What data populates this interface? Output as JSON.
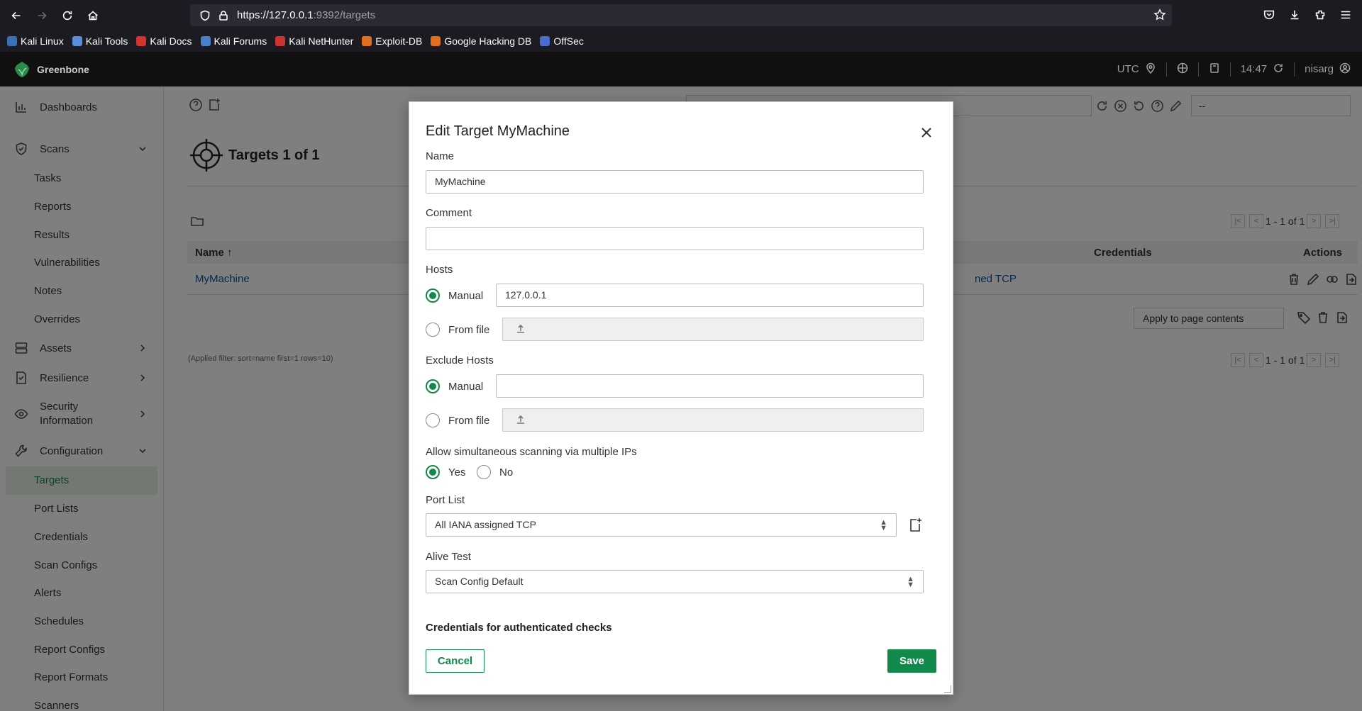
{
  "browser": {
    "url_host": "https://127.0.0.1",
    "url_rest": ":9392/targets",
    "bookmarks": [
      "Kali Linux",
      "Kali Tools",
      "Kali Docs",
      "Kali Forums",
      "Kali NetHunter",
      "Exploit-DB",
      "Google Hacking DB",
      "OffSec"
    ]
  },
  "header": {
    "brand": "Greenbone",
    "timezone": "UTC",
    "time": "14:47",
    "user": "nisarg"
  },
  "sidebar": {
    "dashboards": "Dashboards",
    "scans": "Scans",
    "scans_items": [
      "Tasks",
      "Reports",
      "Results",
      "Vulnerabilities",
      "Notes",
      "Overrides"
    ],
    "assets": "Assets",
    "resilience": "Resilience",
    "security_info_1": "Security",
    "security_info_2": "Information",
    "configuration": "Configuration",
    "config_items": [
      "Targets",
      "Port Lists",
      "Credentials",
      "Scan Configs",
      "Alerts",
      "Schedules",
      "Report Configs",
      "Report Formats",
      "Scanners"
    ]
  },
  "main": {
    "title": "Targets 1 of 1",
    "filter_select": "--",
    "pager_text": "1 - 1 of 1",
    "col_name": "Name",
    "col_credentials": "Credentials",
    "col_actions": "Actions",
    "row_name": "MyMachine",
    "row_portlist_partial": "ned TCP",
    "bulk_select": "Apply to page contents",
    "applied_filter": "(Applied filter: sort=name first=1 rows=10)"
  },
  "modal": {
    "title": "Edit Target MyMachine",
    "name_label": "Name",
    "name_value": "MyMachine",
    "comment_label": "Comment",
    "comment_value": "",
    "hosts_label": "Hosts",
    "manual": "Manual",
    "from_file": "From file",
    "hosts_value": "127.0.0.1",
    "exclude_label": "Exclude Hosts",
    "exclude_value": "",
    "simultaneous_label": "Allow simultaneous scanning via multiple IPs",
    "yes": "Yes",
    "no": "No",
    "portlist_label": "Port List",
    "portlist_value": "All IANA assigned TCP",
    "alive_label": "Alive Test",
    "alive_value": "Scan Config Default",
    "credentials_heading": "Credentials for authenticated checks",
    "cancel": "Cancel",
    "save": "Save"
  },
  "colors": {
    "accent": "#11894a",
    "link": "#0a53a8",
    "header_bg": "#101010"
  }
}
